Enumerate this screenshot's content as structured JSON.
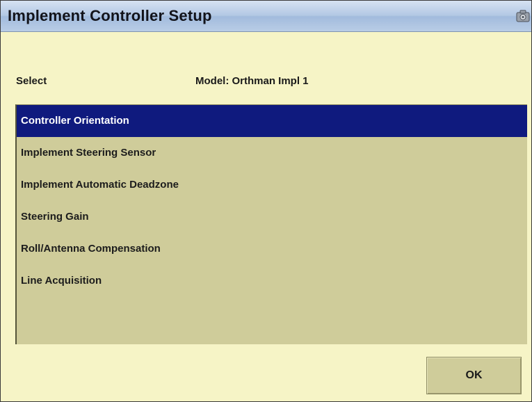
{
  "window": {
    "title": "Implement Controller Setup",
    "title_icon": "camera-icon"
  },
  "header": {
    "select_label": "Select",
    "model_label": "Model: Orthman Impl 1"
  },
  "list": {
    "items": [
      {
        "label": "Controller Orientation",
        "selected": true
      },
      {
        "label": "Implement Steering Sensor",
        "selected": false
      },
      {
        "label": "Implement Automatic Deadzone",
        "selected": false
      },
      {
        "label": "Steering Gain",
        "selected": false
      },
      {
        "label": "Roll/Antenna Compensation",
        "selected": false
      },
      {
        "label": "Line Acquisition",
        "selected": false
      }
    ]
  },
  "buttons": {
    "ok_label": "OK"
  },
  "colors": {
    "background": "#f6f4c6",
    "list_background": "#cfcc9a",
    "selected_item": "#0f1a7e",
    "title_bar": "#b3c8e4"
  }
}
